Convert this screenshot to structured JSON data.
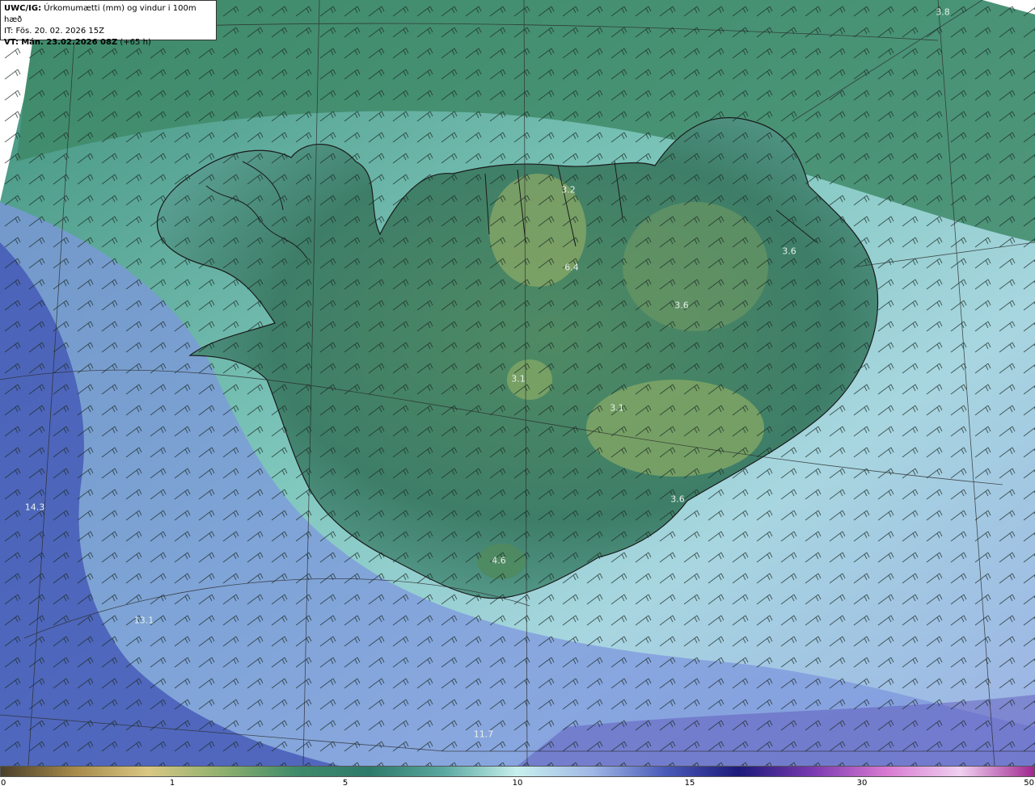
{
  "header": {
    "product": "UWC/IG:",
    "product_desc": "Úrkomumætti (mm) og vindur i 100m hæð",
    "init_time": "IT: Fös. 20. 02. 2026 15Z",
    "valid_prefix": "VT:",
    "valid_time": "Mán. 23.02.2026 08Z",
    "lead": "(+65 h)"
  },
  "map_values": [
    "3.8",
    "3.2",
    "6.4",
    "3.6",
    "3.6",
    "3.1",
    "3.1",
    "3.6",
    "4.6",
    "14.3",
    "13.1",
    "11.7"
  ],
  "colorbar": {
    "ticks": [
      "0",
      "1",
      "5",
      "10",
      "15",
      "30",
      "50"
    ],
    "colors": [
      "#4a3f2a",
      "#a68a4a",
      "#d9c783",
      "#8fb06e",
      "#3f8a6a",
      "#2e7a6a",
      "#5aa8a0",
      "#c8f0ee",
      "#9fb8e6",
      "#4a5ab8",
      "#1c1a7a",
      "#7a3ab0",
      "#d87ad2",
      "#f0d0f0",
      "#a02890"
    ]
  }
}
